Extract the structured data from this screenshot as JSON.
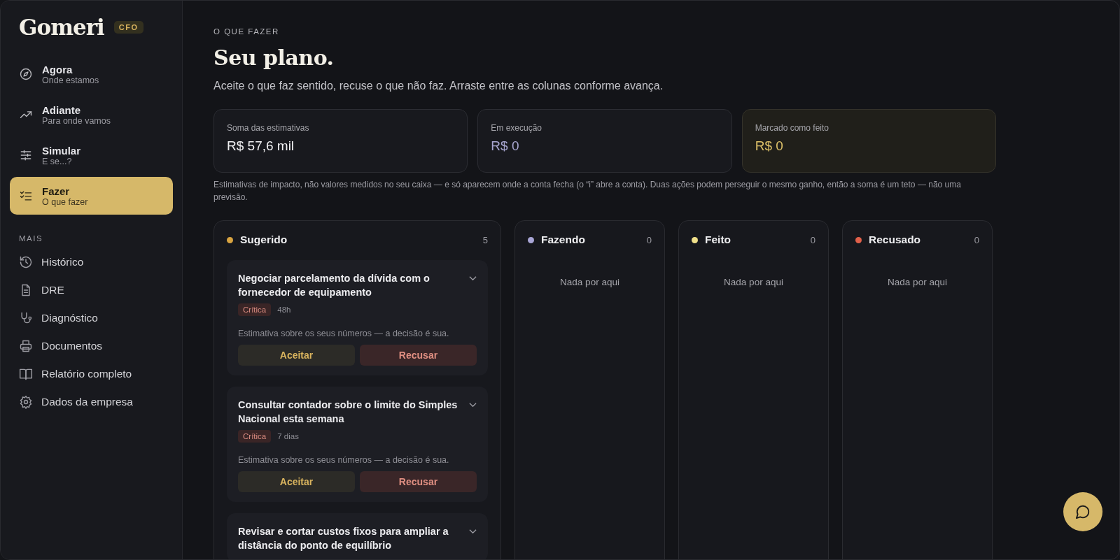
{
  "sidebar": {
    "logo": "Gomeri",
    "badge": "CFO",
    "primary_items": [
      {
        "label": "Agora",
        "sublabel": "Onde estamos",
        "selected": false
      },
      {
        "label": "Adiante",
        "sublabel": "Para onde vamos",
        "selected": false
      },
      {
        "label": "Simular",
        "sublabel": "E se...?",
        "selected": false
      },
      {
        "label": "Fazer",
        "sublabel": "O que fazer",
        "selected": true
      }
    ],
    "section_title": "MAIS",
    "secondary_items": [
      {
        "label": "Histórico"
      },
      {
        "label": "DRE"
      },
      {
        "label": "Diagnóstico"
      },
      {
        "label": "Documentos"
      },
      {
        "label": "Relatório completo"
      },
      {
        "label": "Dados da empresa"
      }
    ]
  },
  "header": {
    "eyebrow": "O QUE FAZER",
    "title": "Seu plano.",
    "subtitle": "Aceite o que faz sentido, recuse o que não faz. Arraste entre as colunas conforme avança."
  },
  "stats": [
    {
      "kind": "neutral",
      "label": "Soma das estimativas",
      "value": "R$ 57,6 mil"
    },
    {
      "kind": "progress",
      "label": "Em execução",
      "value": "R$ 0"
    },
    {
      "kind": "done",
      "label": "Marcado como feito",
      "value": "R$ 0"
    }
  ],
  "disclaimer": "Estimativas de impacto, não valores medidos no seu caixa — e só aparecem onde a conta fecha (o “i” abre a conta). Duas ações podem perseguir o mesmo ganho, então a soma é um teto — não uma previsão.",
  "columns": [
    {
      "title": "Sugerido",
      "count": "5",
      "color": "#d9a441",
      "cards": [
        {
          "title": "Negociar parcelamento da dívida com o fornecedor de equipamento",
          "tag": "Crítica",
          "time": "48h",
          "note": "Estimativa sobre os seus números — a decisão é sua.",
          "buttons": [
            {
              "kind": "accept",
              "label": "Aceitar"
            },
            {
              "kind": "reject",
              "label": "Recusar"
            }
          ]
        },
        {
          "title": "Consultar contador sobre o limite do Simples Nacional esta semana",
          "tag": "Crítica",
          "time": "7 dias",
          "note": "Estimativa sobre os seus números — a decisão é sua.",
          "buttons": [
            {
              "kind": "accept",
              "label": "Aceitar"
            },
            {
              "kind": "reject",
              "label": "Recusar"
            }
          ]
        },
        {
          "title": "Revisar e cortar custos fixos para ampliar a distância do ponto de equilíbrio"
        }
      ]
    },
    {
      "title": "Fazendo",
      "count": "0",
      "color": "#a9a6d6",
      "empty": "Nada por aqui"
    },
    {
      "title": "Feito",
      "count": "0",
      "color": "#f0e08a",
      "empty": "Nada por aqui"
    },
    {
      "title": "Recusado",
      "count": "0",
      "color": "#e0604a",
      "empty": "Nada por aqui"
    }
  ]
}
